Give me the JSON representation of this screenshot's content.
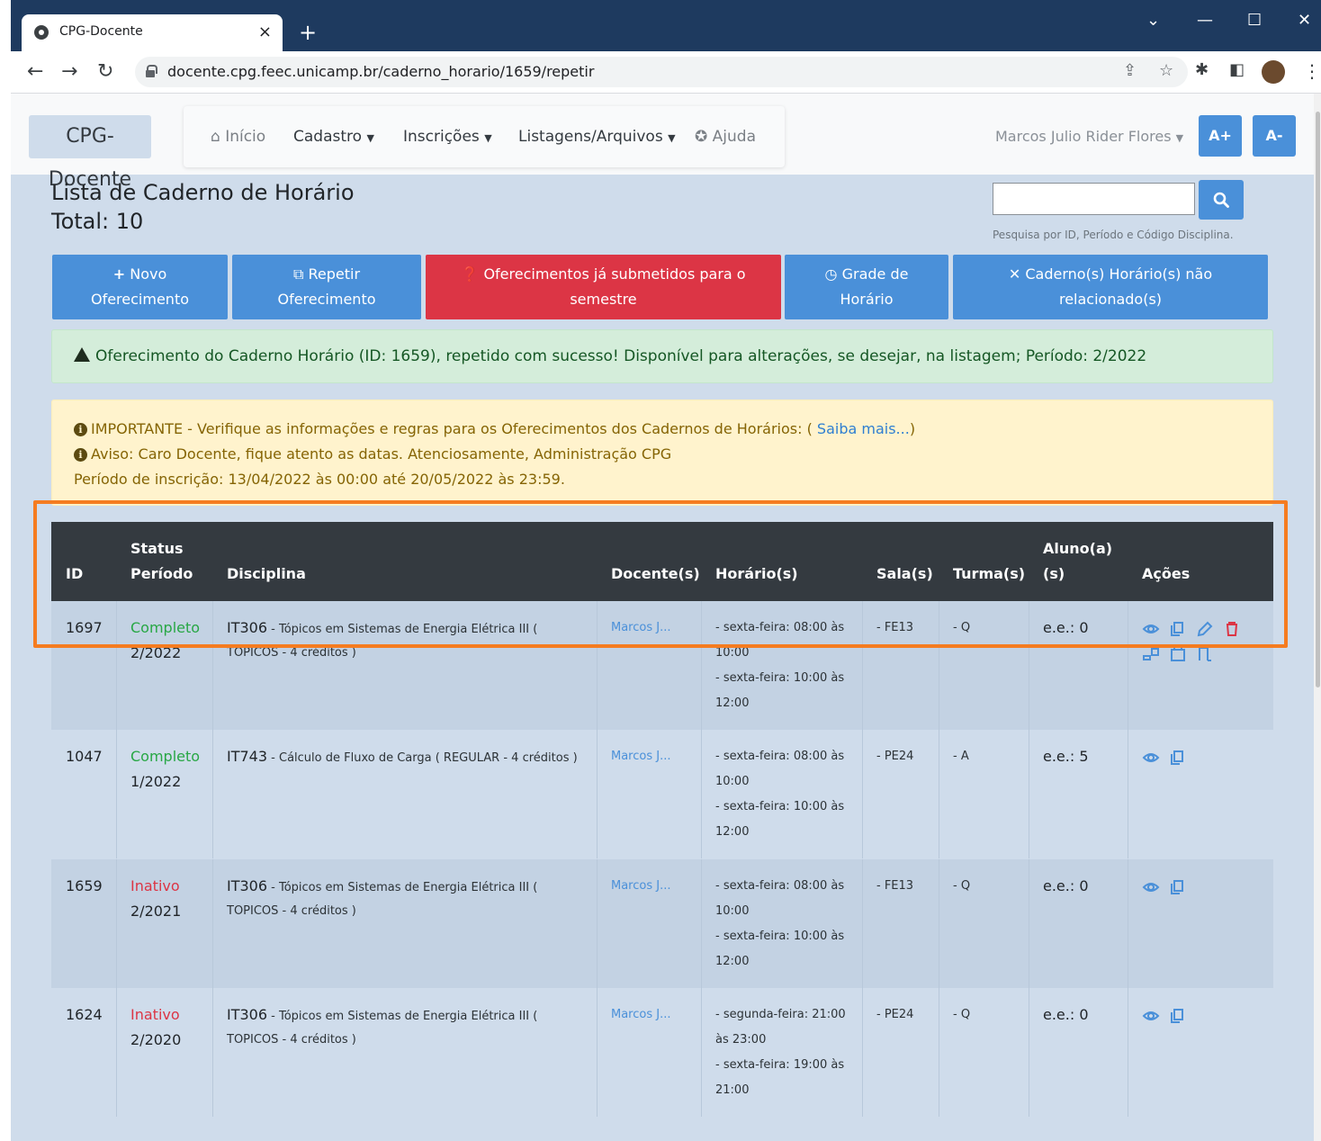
{
  "browser": {
    "tab_title": "CPG-Docente",
    "tab_close": "×",
    "new_tab": "+",
    "url": "docente.cpg.feec.unicamp.br/caderno_horario/1659/repetir",
    "win_min": "—",
    "win_max": "☐",
    "win_close": "✕",
    "win_down": "⌄"
  },
  "navbar": {
    "brand": "CPG-Docente",
    "inicio": "Início",
    "cadastro": "Cadastro",
    "inscricoes": "Inscrições",
    "listagens": "Listagens/Arquivos",
    "ajuda": "Ajuda",
    "user": "Marcos Julio Rider Flores",
    "font_up": "A+",
    "font_down": "A-"
  },
  "header": {
    "title": "Lista de Caderno de Horário",
    "total": "Total: 10",
    "search_hint": "Pesquisa por ID, Período e Código Disciplina."
  },
  "actions": {
    "novo_1": "Novo",
    "novo_2": "Oferecimento",
    "repetir_1": "Repetir",
    "repetir_2": "Oferecimento",
    "submetidos_1": "Oferecimentos já submetidos para o",
    "submetidos_2": "semestre",
    "grade_1": "Grade de",
    "grade_2": "Horário",
    "caderno_1": "Caderno(s) Horário(s) não",
    "caderno_2": "relacionado(s)"
  },
  "alerts": {
    "success": "Oferecimento do Caderno Horário (ID: 1659), repetido com sucesso! Disponível para alterações, se desejar, na listagem; Período: 2/2022",
    "important": "IMPORTANTE - Verifique as informações e regras para os Oferecimentos dos Cadernos de Horários: (",
    "saiba_mais": "Saiba mais...",
    "important_close": ")",
    "aviso": "Aviso: Caro Docente, fique atento as datas. Atenciosamente, Administração CPG",
    "periodo": "Período de inscrição: 13/04/2022 às 00:00 até 20/05/2022 às 23:59."
  },
  "table": {
    "headers": {
      "id": "ID",
      "status": "Status",
      "periodo": "Período",
      "disciplina": "Disciplina",
      "docentes": "Docente(s)",
      "horarios": "Horário(s)",
      "salas": "Sala(s)",
      "turmas": "Turma(s)",
      "alunos_1": "Aluno(a)",
      "alunos_2": "(s)",
      "acoes": "Ações"
    },
    "rows": [
      {
        "id": "1697",
        "status": "Completo",
        "periodo": "2/2022",
        "code": "IT306",
        "disc_1": " - Tópicos em Sistemas de Energia Elétrica III (",
        "disc_2": "TOPICOS - 4 créditos )",
        "docente": "Marcos J...",
        "h1": "- sexta-feira: 08:00 às",
        "h2": "10:00",
        "h3": "- sexta-feira: 10:00 às",
        "h4": "12:00",
        "sala": "- FE13",
        "turma": "- Q",
        "alunos": "e.e.: 0"
      },
      {
        "id": "1047",
        "status": "Completo",
        "periodo": "1/2022",
        "code": "IT743",
        "disc_1": " - Cálculo de Fluxo de Carga ( REGULAR - 4 créditos )",
        "disc_2": "",
        "docente": "Marcos J...",
        "h1": "- sexta-feira: 08:00 às",
        "h2": "10:00",
        "h3": "- sexta-feira: 10:00 às",
        "h4": "12:00",
        "sala": "- PE24",
        "turma": "- A",
        "alunos": "e.e.: 5"
      },
      {
        "id": "1659",
        "status": "Inativo",
        "periodo": "2/2021",
        "code": "IT306",
        "disc_1": " - Tópicos em Sistemas de Energia Elétrica III (",
        "disc_2": "TOPICOS - 4 créditos )",
        "docente": "Marcos J...",
        "h1": "- sexta-feira: 08:00 às",
        "h2": "10:00",
        "h3": "- sexta-feira: 10:00 às",
        "h4": "12:00",
        "sala": "- FE13",
        "turma": "- Q",
        "alunos": "e.e.: 0"
      },
      {
        "id": "1624",
        "status": "Inativo",
        "periodo": "2/2020",
        "code": "IT306",
        "disc_1": " - Tópicos em Sistemas de Energia Elétrica III (",
        "disc_2": "TOPICOS - 4 créditos )",
        "docente": "Marcos J...",
        "h1": "- segunda-feira: 21:00",
        "h2": "às 23:00",
        "h3": "- sexta-feira: 19:00 às",
        "h4": "21:00",
        "sala": "- PE24",
        "turma": "- Q",
        "alunos": "e.e.: 0"
      }
    ]
  },
  "colors": {
    "primary": "#4a90d9",
    "danger": "#dc3545",
    "success": "#28a745",
    "highlight": "#f57c20"
  }
}
